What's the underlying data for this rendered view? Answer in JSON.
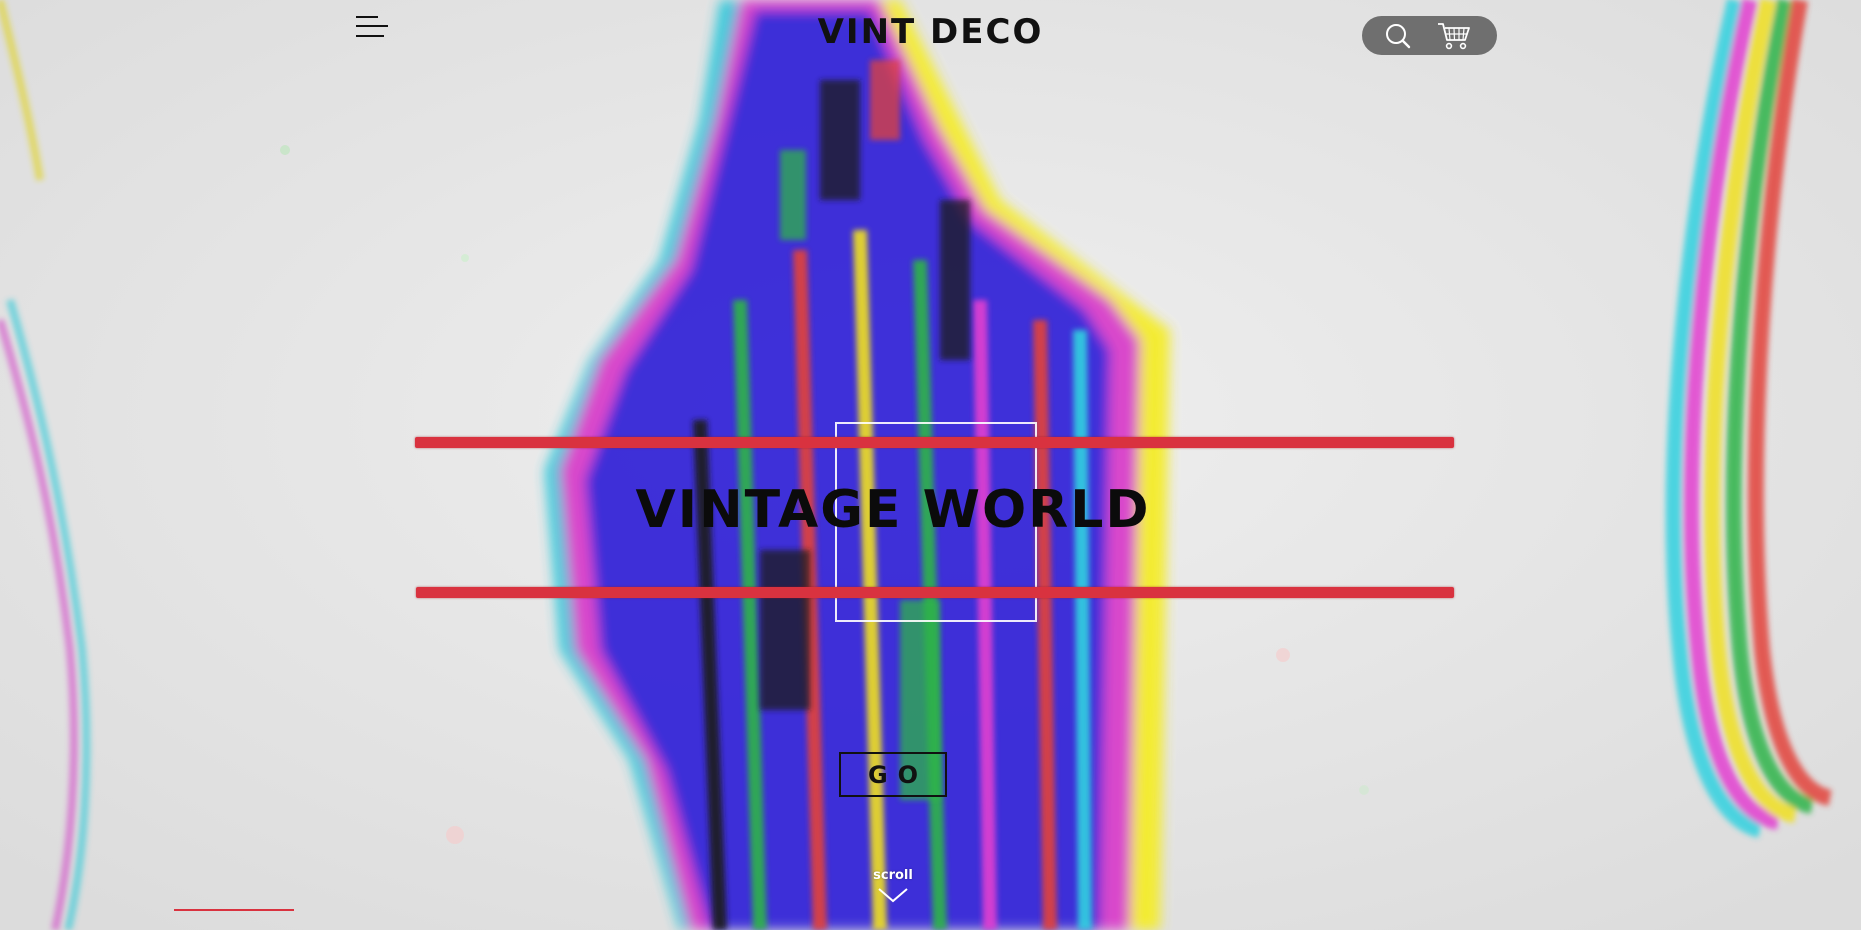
{
  "header": {
    "brand": "VINT DECO",
    "menu_icon": "hamburger-menu-icon",
    "actions": [
      {
        "name": "search",
        "icon": "search-icon"
      },
      {
        "name": "cart",
        "icon": "shopping-cart-icon"
      }
    ]
  },
  "hero": {
    "title": "VINTAGE WORLD",
    "cta_label": "GO",
    "accent_color": "#d9323f"
  },
  "scroll": {
    "label": "scroll",
    "icon": "chevron-down-icon"
  },
  "colors": {
    "accent": "#d9323f",
    "text": "#111111",
    "pill": "#5f5f5f"
  }
}
